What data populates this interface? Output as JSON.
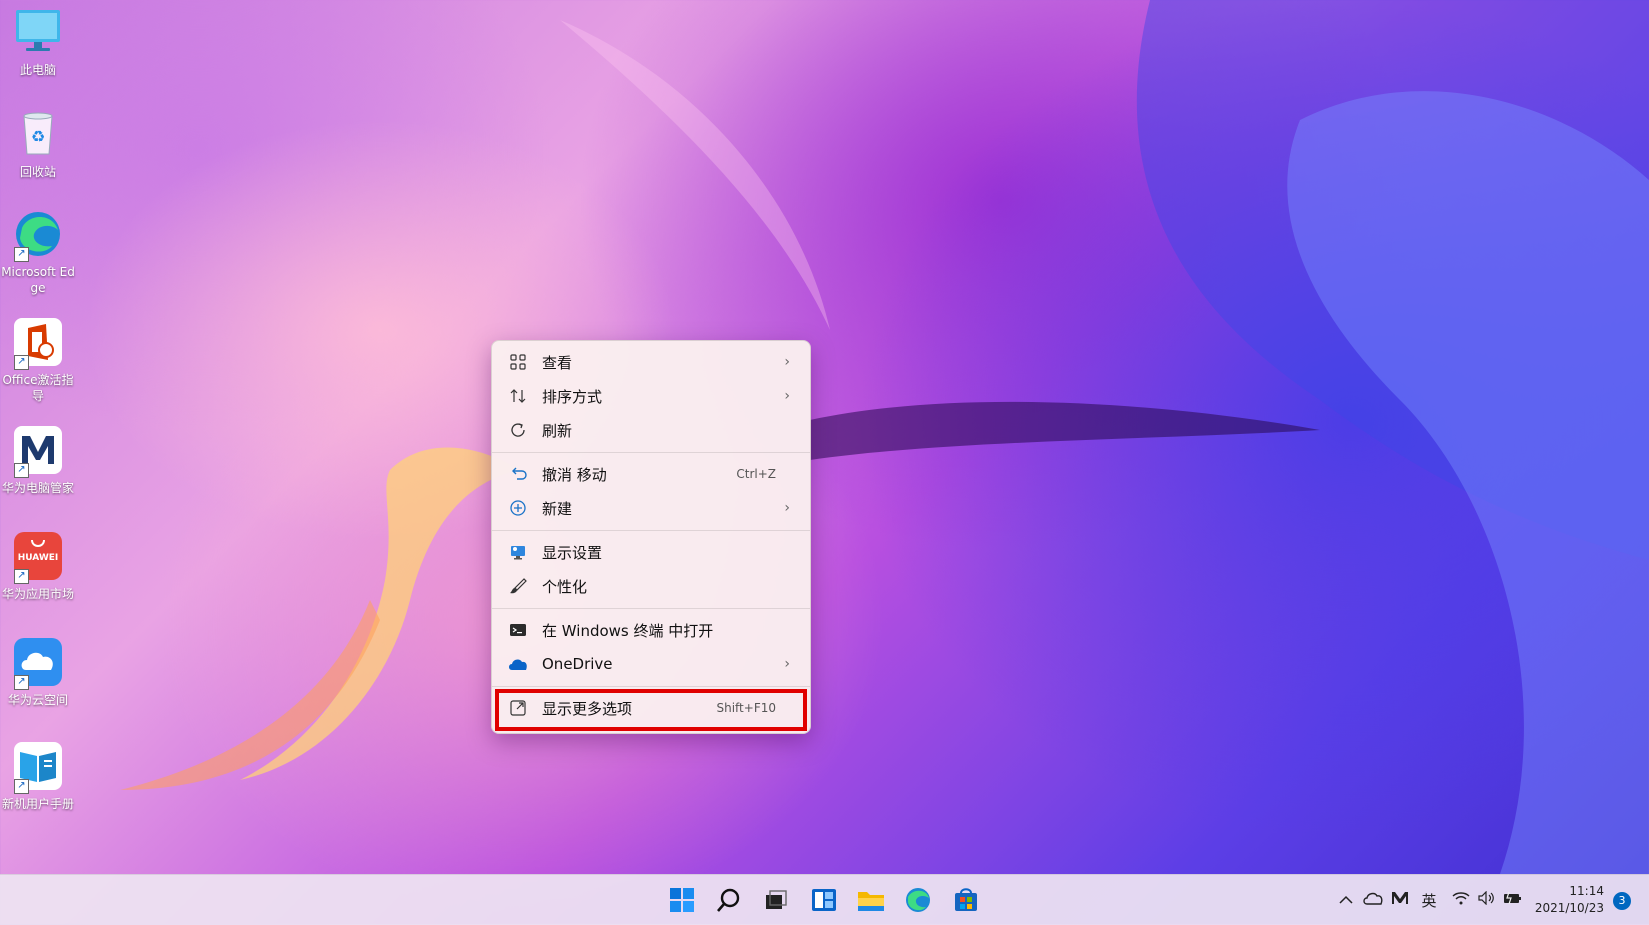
{
  "desktop_icons": [
    {
      "label": "此电脑",
      "icon": "computer-icon"
    },
    {
      "label": "回收站",
      "icon": "recycle-bin-icon"
    },
    {
      "label": "Microsoft Edge",
      "icon": "edge-icon"
    },
    {
      "label": "Office激活指导",
      "icon": "office-icon"
    },
    {
      "label": "华为电脑管家",
      "icon": "huawei-pc-manager-icon"
    },
    {
      "label": "华为应用市场",
      "icon": "huawei-appgallery-icon",
      "logo_text": "HUAWEI"
    },
    {
      "label": "华为云空间",
      "icon": "huawei-cloud-icon"
    },
    {
      "label": "新机用户手册",
      "icon": "user-manual-icon"
    }
  ],
  "context_menu": {
    "items": [
      {
        "label": "查看",
        "icon": "grid-icon",
        "submenu": true
      },
      {
        "label": "排序方式",
        "icon": "sort-icon",
        "submenu": true
      },
      {
        "label": "刷新",
        "icon": "refresh-icon"
      },
      {
        "label": "撤消 移动",
        "icon": "undo-icon",
        "shortcut": "Ctrl+Z"
      },
      {
        "label": "新建",
        "icon": "new-plus-icon",
        "submenu": true
      },
      {
        "label": "显示设置",
        "icon": "display-settings-icon"
      },
      {
        "label": "个性化",
        "icon": "brush-icon"
      },
      {
        "label": "在 Windows 终端 中打开",
        "icon": "terminal-icon"
      },
      {
        "label": "OneDrive",
        "icon": "onedrive-icon",
        "submenu": true
      },
      {
        "label": "显示更多选项",
        "icon": "more-options-icon",
        "shortcut": "Shift+F10",
        "highlighted": true
      }
    ],
    "highlight_color": "#e00000"
  },
  "taskbar": {
    "apps": [
      "start-icon",
      "search-icon",
      "task-view-icon",
      "widgets-icon",
      "file-explorer-icon",
      "edge-icon",
      "store-icon"
    ],
    "tray": {
      "input_language": "英",
      "time": "11:14",
      "date": "2021/10/23",
      "notification_count": "3"
    }
  }
}
